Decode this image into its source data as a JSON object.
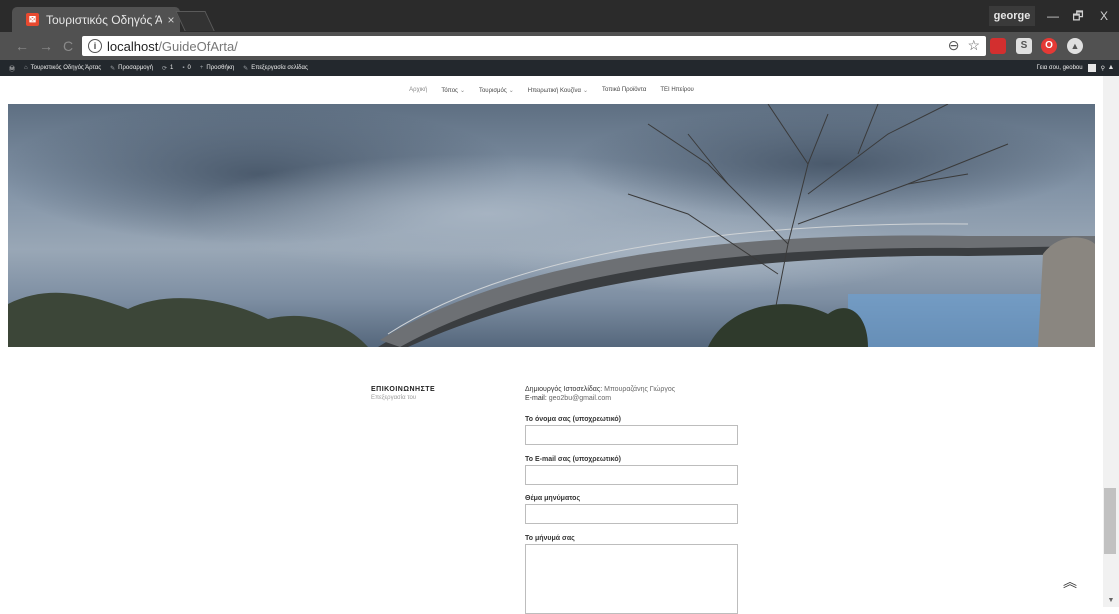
{
  "browser": {
    "tab_title": "Τουριστικός Οδηγός Άρ",
    "tab_close": "×",
    "favicon_glyph": "⊠",
    "profile_name": "george",
    "window_minimize": "—",
    "window_restore": "🗗",
    "window_close": "X",
    "back_glyph": "←",
    "forward_glyph": "→",
    "reload_glyph": "C",
    "info_glyph": "i",
    "url_host": "localhost",
    "url_path": "/GuideOfArta/",
    "zoom_glyph": "⊖",
    "star_glyph": "☆",
    "extensions": [
      {
        "name": "ext-red",
        "color": "#d32f2f"
      },
      {
        "name": "ext-s",
        "color": "#e0e0e0",
        "glyph": "S"
      },
      {
        "name": "ext-opera",
        "color": "#e53935",
        "glyph": "O"
      },
      {
        "name": "ext-drive",
        "color": "#e0e0e0",
        "glyph": "▲"
      }
    ]
  },
  "adminbar": {
    "wp_glyph": "Ⓦ",
    "items": [
      {
        "glyph": "⌂",
        "label": "Τουριστικός Οδηγός Άρτας"
      },
      {
        "glyph": "✎",
        "label": "Προσαρμογή"
      },
      {
        "glyph": "⟳",
        "label": "1"
      },
      {
        "glyph": "▪",
        "label": "0"
      },
      {
        "glyph": "+",
        "label": "Προσθήκη"
      },
      {
        "glyph": "✎",
        "label": "Επεξεργασία σελίδας"
      }
    ],
    "greeting": "Γεια σου, geobou",
    "search_glyph": "⚲",
    "scroll_up": "▲"
  },
  "nav": {
    "items": [
      {
        "label": "Αρχική",
        "dropdown": false,
        "current": true
      },
      {
        "label": "Τόπος",
        "dropdown": true
      },
      {
        "label": "Τουρισμός",
        "dropdown": true
      },
      {
        "label": "Ηπειρωτική Κουζίνα",
        "dropdown": true
      },
      {
        "label": "Τοπικά Προϊόντα",
        "dropdown": false
      },
      {
        "label": "ΤΕΙ Ηπείρου",
        "dropdown": false
      }
    ],
    "caret": "⌄"
  },
  "contact": {
    "title": "ΕΠΙΚΟΙΝΩΝΗΣΤΕ",
    "subtitle": "Επεξεργασία του",
    "creator_label": "Δημιουργός Ιστοσελίδας:",
    "creator_value": "Μπουραζάνης Γιώργος",
    "email_label": "E-mail:",
    "email_value": "geo2bu@gmail.com",
    "fields": [
      {
        "label": "Το όνομα σας (υποχρεωτικό)",
        "value": ""
      },
      {
        "label": "Το E-mail σας (υποχρεωτικό)",
        "value": ""
      },
      {
        "label": "Θέμα μηνύματος",
        "value": ""
      },
      {
        "label": "Το μήνυμά σας",
        "value": ""
      }
    ]
  },
  "back_to_top_glyph": "︽",
  "scroll_down_glyph": "▼",
  "colors": {
    "chrome_dark": "#2b2b2b",
    "chrome_toolbar": "#515151",
    "wp_adminbar": "#23282d",
    "favicon": "#e8492f"
  }
}
